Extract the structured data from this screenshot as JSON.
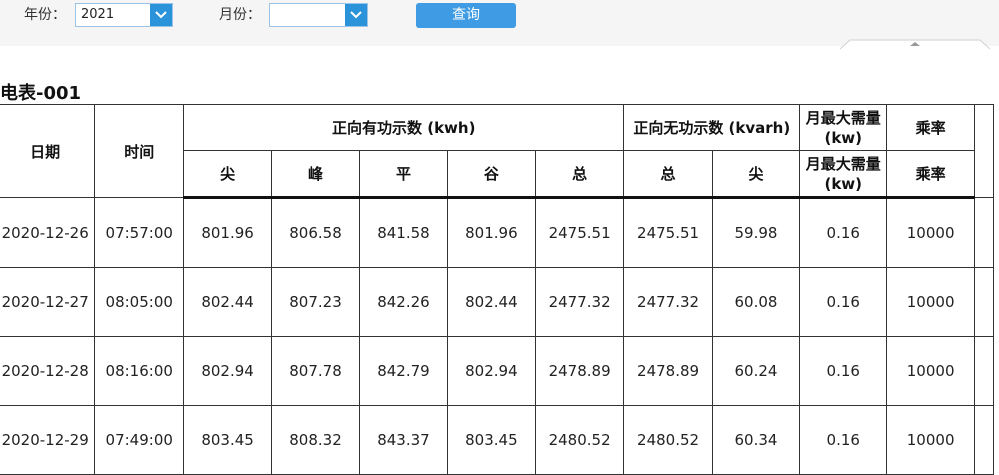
{
  "filters": {
    "year_label": "年份：",
    "year_value": "2021",
    "month_label": "月份：",
    "month_value": "",
    "query_button": "查询"
  },
  "table_title": "电表-001",
  "header": {
    "date": "日期",
    "time": "时间",
    "active_group": "正向有功示数 (kwh)",
    "reactive_group": "正向无功示数 (kvarh)",
    "max_demand_top": "月最大需量 (kw)",
    "ratio_top": "乘率",
    "sub": [
      "尖",
      "峰",
      "平",
      "谷",
      "总",
      "总",
      "尖",
      "月最大需量 (kw)",
      "乘率"
    ]
  },
  "rows": [
    [
      "2020-12-26",
      "07:57:00",
      "801.96",
      "806.58",
      "841.58",
      "801.96",
      "2475.51",
      "2475.51",
      "59.98",
      "0.16",
      "10000"
    ],
    [
      "2020-12-27",
      "08:05:00",
      "802.44",
      "807.23",
      "842.26",
      "802.44",
      "2477.32",
      "2477.32",
      "60.08",
      "0.16",
      "10000"
    ],
    [
      "2020-12-28",
      "08:16:00",
      "802.94",
      "807.78",
      "842.79",
      "802.94",
      "2478.89",
      "2478.89",
      "60.24",
      "0.16",
      "10000"
    ],
    [
      "2020-12-29",
      "07:49:00",
      "803.45",
      "808.32",
      "843.37",
      "803.45",
      "2480.52",
      "2480.52",
      "60.34",
      "0.16",
      "10000"
    ]
  ],
  "colors": {
    "accent": "#3f9be3",
    "combo_arrow": "#2b93d9",
    "filter_bg": "#f5f5f5"
  },
  "icons": {
    "year_dropdown": "chevron-down-icon",
    "month_dropdown": "chevron-down-icon",
    "collapse": "chevron-up-icon"
  }
}
